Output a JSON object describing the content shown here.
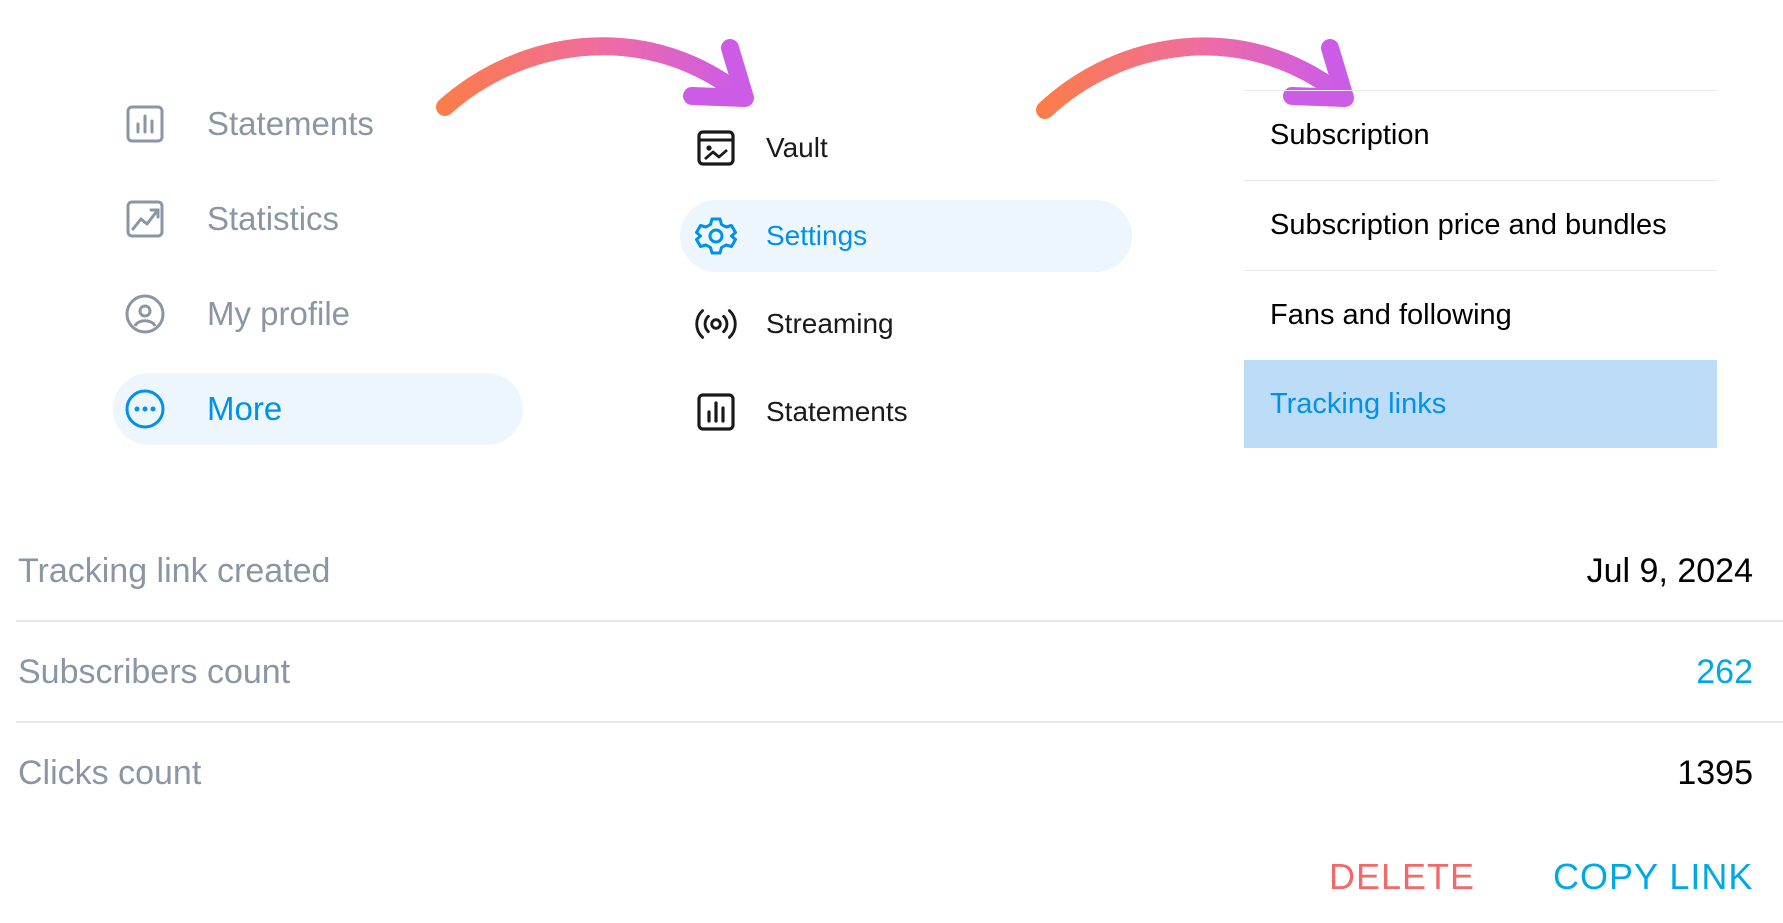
{
  "panel_more_menu": {
    "items": [
      {
        "label": "Statements",
        "icon": "bar-chart-icon"
      },
      {
        "label": "Statistics",
        "icon": "trend-chart-icon"
      },
      {
        "label": "My profile",
        "icon": "profile-icon"
      },
      {
        "label": "More",
        "icon": "more-dots-icon",
        "active": true
      }
    ]
  },
  "panel_more_submenu": {
    "items": [
      {
        "label": "Vault",
        "icon": "vault-icon"
      },
      {
        "label": "Settings",
        "icon": "gear-icon",
        "active": true
      },
      {
        "label": "Streaming",
        "icon": "streaming-icon"
      },
      {
        "label": "Statements",
        "icon": "bar-chart-icon"
      }
    ]
  },
  "panel_settings": {
    "items": [
      {
        "label": "Subscription"
      },
      {
        "label": "Subscription price and bundles"
      },
      {
        "label": "Fans and following"
      },
      {
        "label": "Tracking links",
        "active": true
      }
    ]
  },
  "tracking_link": {
    "rows": [
      {
        "key": "Tracking link created",
        "value": "Jul 9, 2024"
      },
      {
        "key": "Subscribers count",
        "value": "262"
      },
      {
        "key": "Clicks count",
        "value": "1395"
      }
    ],
    "actions": {
      "delete_label": "DELETE",
      "copy_label": "COPY LINK"
    }
  },
  "colors": {
    "accent": "#0091ea",
    "active_bg": "#eef6fd",
    "selected_row_bg": "#bddcf8",
    "muted_text": "#8a96a3",
    "delete_red": "#f06a6a",
    "arrow_start": "#fb7c4a",
    "arrow_end": "#cc5ce6"
  }
}
